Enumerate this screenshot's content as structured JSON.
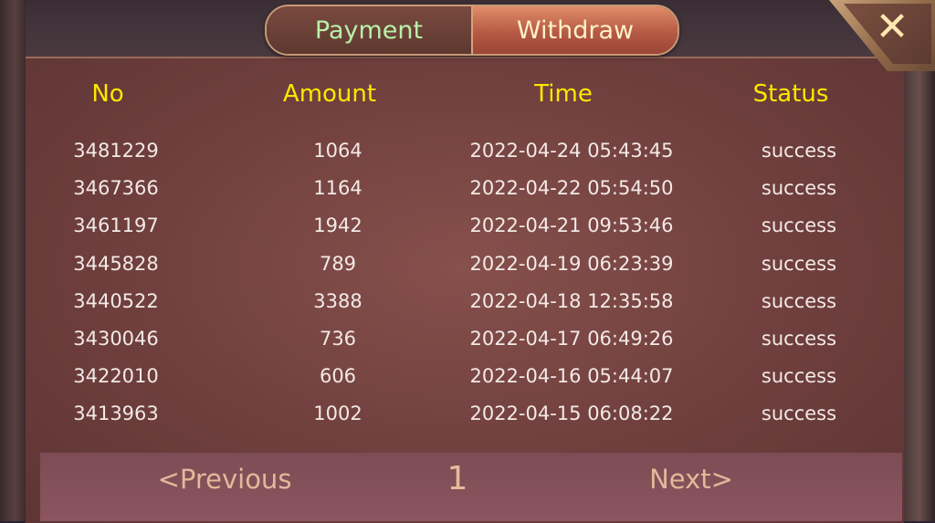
{
  "tabs": {
    "payment": "Payment",
    "withdraw": "Withdraw",
    "active": "withdraw"
  },
  "close_label": "✕",
  "table": {
    "headers": {
      "no": "No",
      "amount": "Amount",
      "time": "Time",
      "status": "Status"
    },
    "rows": [
      {
        "no": "3481229",
        "amount": "1064",
        "time": "2022-04-24 05:43:45",
        "status": "success"
      },
      {
        "no": "3467366",
        "amount": "1164",
        "time": "2022-04-22 05:54:50",
        "status": "success"
      },
      {
        "no": "3461197",
        "amount": "1942",
        "time": "2022-04-21 09:53:46",
        "status": "success"
      },
      {
        "no": "3445828",
        "amount": "789",
        "time": "2022-04-19 06:23:39",
        "status": "success"
      },
      {
        "no": "3440522",
        "amount": "3388",
        "time": "2022-04-18 12:35:58",
        "status": "success"
      },
      {
        "no": "3430046",
        "amount": "736",
        "time": "2022-04-17 06:49:26",
        "status": "success"
      },
      {
        "no": "3422010",
        "amount": "606",
        "time": "2022-04-16 05:44:07",
        "status": "success"
      },
      {
        "no": "3413963",
        "amount": "1002",
        "time": "2022-04-15 06:08:22",
        "status": "success"
      }
    ]
  },
  "pagination": {
    "previous": "<Previous",
    "page": "1",
    "next": "Next>"
  },
  "colors": {
    "header": "#ffe700",
    "payment_tab_text": "#b8f0a8",
    "withdraw_tab_text": "#fff1c8"
  }
}
